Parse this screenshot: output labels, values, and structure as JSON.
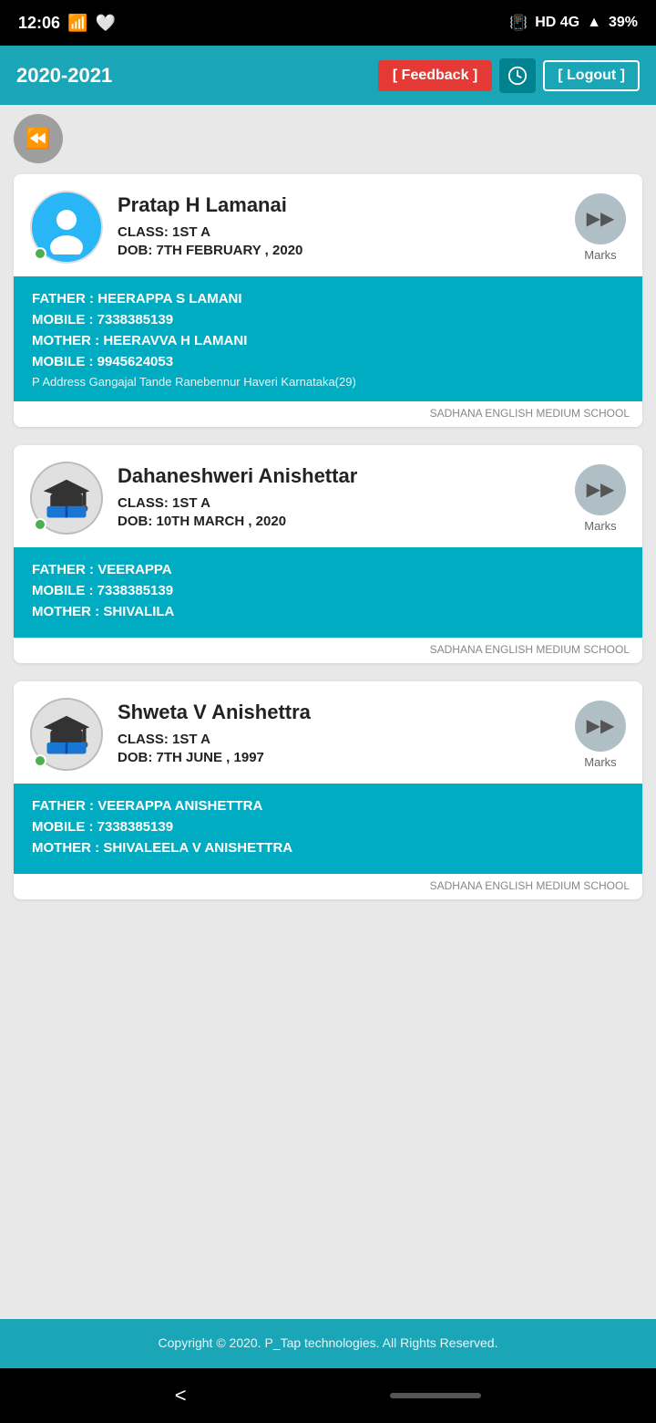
{
  "statusBar": {
    "time": "12:06",
    "network": "HD 4G",
    "battery": "39%"
  },
  "header": {
    "year": "2020-2021",
    "feedbackLabel": "[ Feedback ]",
    "logoutLabel": "[ Logout ]"
  },
  "students": [
    {
      "name": "Pratap H Lamanai",
      "avatarType": "person",
      "class": "CLASS: 1ST A",
      "dob": "DOB: 7TH FEBRUARY , 2020",
      "marksLabel": "Marks",
      "father": "FATHER : HEERAPPA S LAMANI",
      "fatherMobile": "MOBILE : 7338385139",
      "mother": "MOTHER : HEERAVVA H LAMANI",
      "motherMobile": "MOBILE : 9945624053",
      "address": "P Address Gangajal Tande Ranebennur Haveri Karnataka(29)",
      "school": "SADHANA ENGLISH MEDIUM SCHOOL"
    },
    {
      "name": "Dahaneshweri Anishettar",
      "avatarType": "grad",
      "class": "CLASS: 1ST A",
      "dob": "DOB: 10TH MARCH , 2020",
      "marksLabel": "Marks",
      "father": "FATHER : VEERAPPA",
      "fatherMobile": "MOBILE : 7338385139",
      "mother": "MOTHER : SHIVALILA",
      "motherMobile": "",
      "address": "",
      "school": "SADHANA ENGLISH MEDIUM SCHOOL"
    },
    {
      "name": "Shweta V Anishettra",
      "avatarType": "grad",
      "class": "CLASS: 1ST A",
      "dob": "DOB: 7TH JUNE , 1997",
      "marksLabel": "Marks",
      "father": "FATHER : VEERAPPA ANISHETTRA",
      "fatherMobile": "MOBILE : 7338385139",
      "mother": "MOTHER : SHIVALEELA V ANISHETTRA",
      "motherMobile": "",
      "address": "",
      "school": "SADHANA ENGLISH MEDIUM SCHOOL"
    }
  ],
  "footer": {
    "copyright": "Copyright © 2020. P_Tap technologies. All Rights Reserved."
  },
  "nav": {
    "backLabel": "<"
  }
}
